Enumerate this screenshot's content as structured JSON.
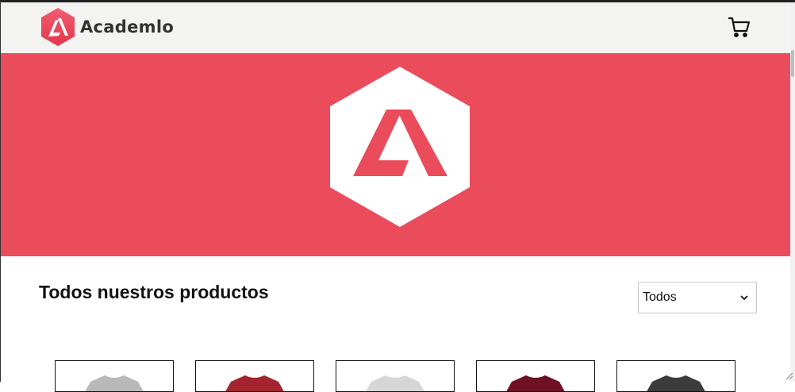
{
  "brand": {
    "name": "Academlo",
    "primary_color": "#ea4c5c",
    "logo_icon": "academlo-hexagon-logo"
  },
  "header": {
    "background": "#f3f3f1",
    "cart_icon": "cart-icon"
  },
  "hero": {
    "background": "#ea4c5c",
    "logo_icon": "academlo-hexagon-logo"
  },
  "products_section": {
    "title": "Todos nuestros productos",
    "filter": {
      "selected": "Todos"
    },
    "products": [
      {
        "icon": "tshirt-icon",
        "color": "#b9b9b9"
      },
      {
        "icon": "tshirt-icon",
        "color": "#a3232e"
      },
      {
        "icon": "tshirt-icon",
        "color": "#d6d6d6"
      },
      {
        "icon": "tshirt-icon",
        "color": "#6e1122"
      },
      {
        "icon": "tshirt-icon",
        "color": "#3c3c3c"
      }
    ]
  }
}
